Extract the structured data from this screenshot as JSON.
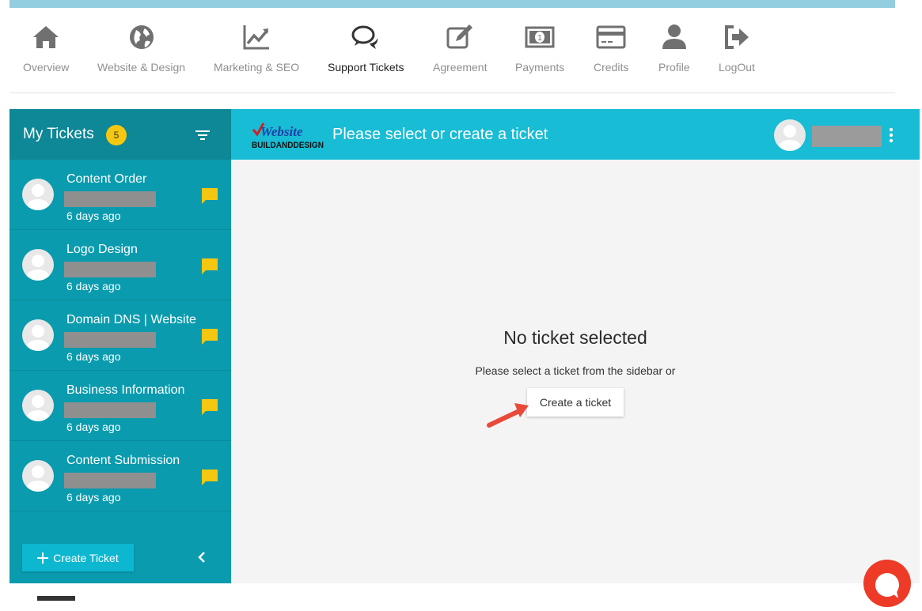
{
  "nav": {
    "items": [
      {
        "label": "Overview",
        "icon": "home-icon"
      },
      {
        "label": "Website & Design",
        "icon": "globe-icon"
      },
      {
        "label": "Marketing & SEO",
        "icon": "chart-line-icon"
      },
      {
        "label": "Support Tickets",
        "icon": "chat-bubbles-icon",
        "active": true
      },
      {
        "label": "Agreement",
        "icon": "edit-icon"
      },
      {
        "label": "Payments",
        "icon": "money-icon"
      },
      {
        "label": "Credits",
        "icon": "credit-card-icon"
      },
      {
        "label": "Profile",
        "icon": "user-icon"
      },
      {
        "label": "LogOut",
        "icon": "logout-icon"
      }
    ]
  },
  "sidebar": {
    "title": "My Tickets",
    "count": "5",
    "tickets": [
      {
        "title": "Content Order",
        "time": "6 days ago"
      },
      {
        "title": "Logo Design",
        "time": "6 days ago"
      },
      {
        "title": "Domain DNS | Website",
        "time": "6 days ago"
      },
      {
        "title": "Business Information",
        "time": "6 days ago"
      },
      {
        "title": "Content Submission",
        "time": "6 days ago"
      }
    ],
    "create_label": "Create Ticket"
  },
  "header": {
    "logo_top": "Website",
    "logo_bottom": "BUILDANDDESIGN",
    "title": "Please select or create a ticket"
  },
  "main": {
    "empty_title": "No ticket selected",
    "empty_sub": "Please select a ticket from the sidebar or",
    "create_link": "Create a ticket"
  },
  "colors": {
    "sidebar": "#0a9bae",
    "header": "#18bcd4",
    "badge": "#f5c710",
    "chat_fab": "#ed3b28"
  }
}
